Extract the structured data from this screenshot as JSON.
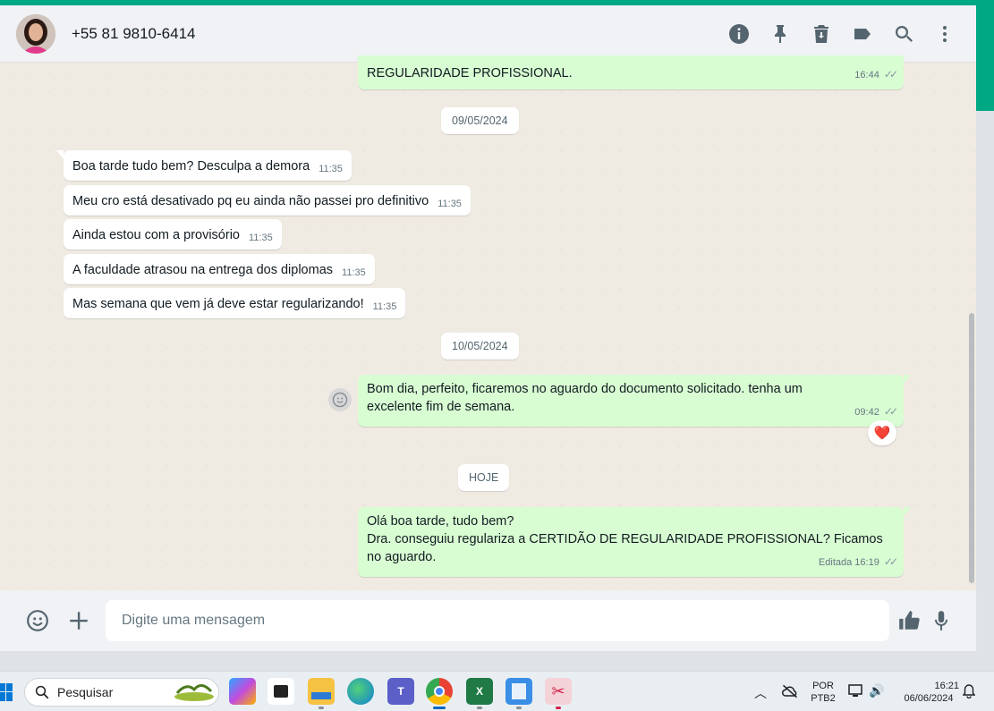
{
  "header": {
    "contact_name": "+55 81 9810-6414",
    "icons": [
      "info-icon",
      "pin-icon",
      "clear-chat-icon",
      "label-icon",
      "search-icon",
      "menu-icon"
    ]
  },
  "messages": {
    "top_partial": {
      "text": "REGULARIDADE PROFISSIONAL.",
      "time": "16:44"
    },
    "date1": "09/05/2024",
    "incoming": [
      {
        "text": "Boa tarde tudo bem? Desculpa a demora",
        "time": "11:35"
      },
      {
        "text": "Meu cro está desativado pq eu ainda não passei pro definitivo",
        "time": "11:35"
      },
      {
        "text": "Ainda estou com a provisório",
        "time": "11:35"
      },
      {
        "text": "A faculdade atrasou na entrega dos diplomas",
        "time": "11:35"
      },
      {
        "text": "Mas semana que vem já deve estar regularizando!",
        "time": "11:35"
      }
    ],
    "date2": "10/05/2024",
    "out1": {
      "line1": "Bom dia, perfeito, ficaremos no aguardo do documento solicitado. tenha um",
      "line2": "excelente fim de semana.",
      "time": "09:42",
      "reaction": "❤️"
    },
    "date3": "HOJE",
    "out2": {
      "line1": "Olá boa tarde, tudo bem?",
      "line2": "Dra. conseguiu regulariza a CERTIDÃO DE REGULARIDADE PROFISSIONAL? Ficamos",
      "line3": "no aguardo.",
      "edited": "Editada",
      "time": "16:19"
    }
  },
  "composer": {
    "placeholder": "Digite uma mensagem"
  },
  "taskbar": {
    "search_label": "Pesquisar",
    "lang_top": "POR",
    "lang_bottom": "PTB2",
    "clock_time": "16:21",
    "clock_date": "06/06/2024"
  },
  "colors": {
    "accent": "#00a884",
    "outgoing": "#d9fdd3",
    "incoming": "#ffffff"
  }
}
